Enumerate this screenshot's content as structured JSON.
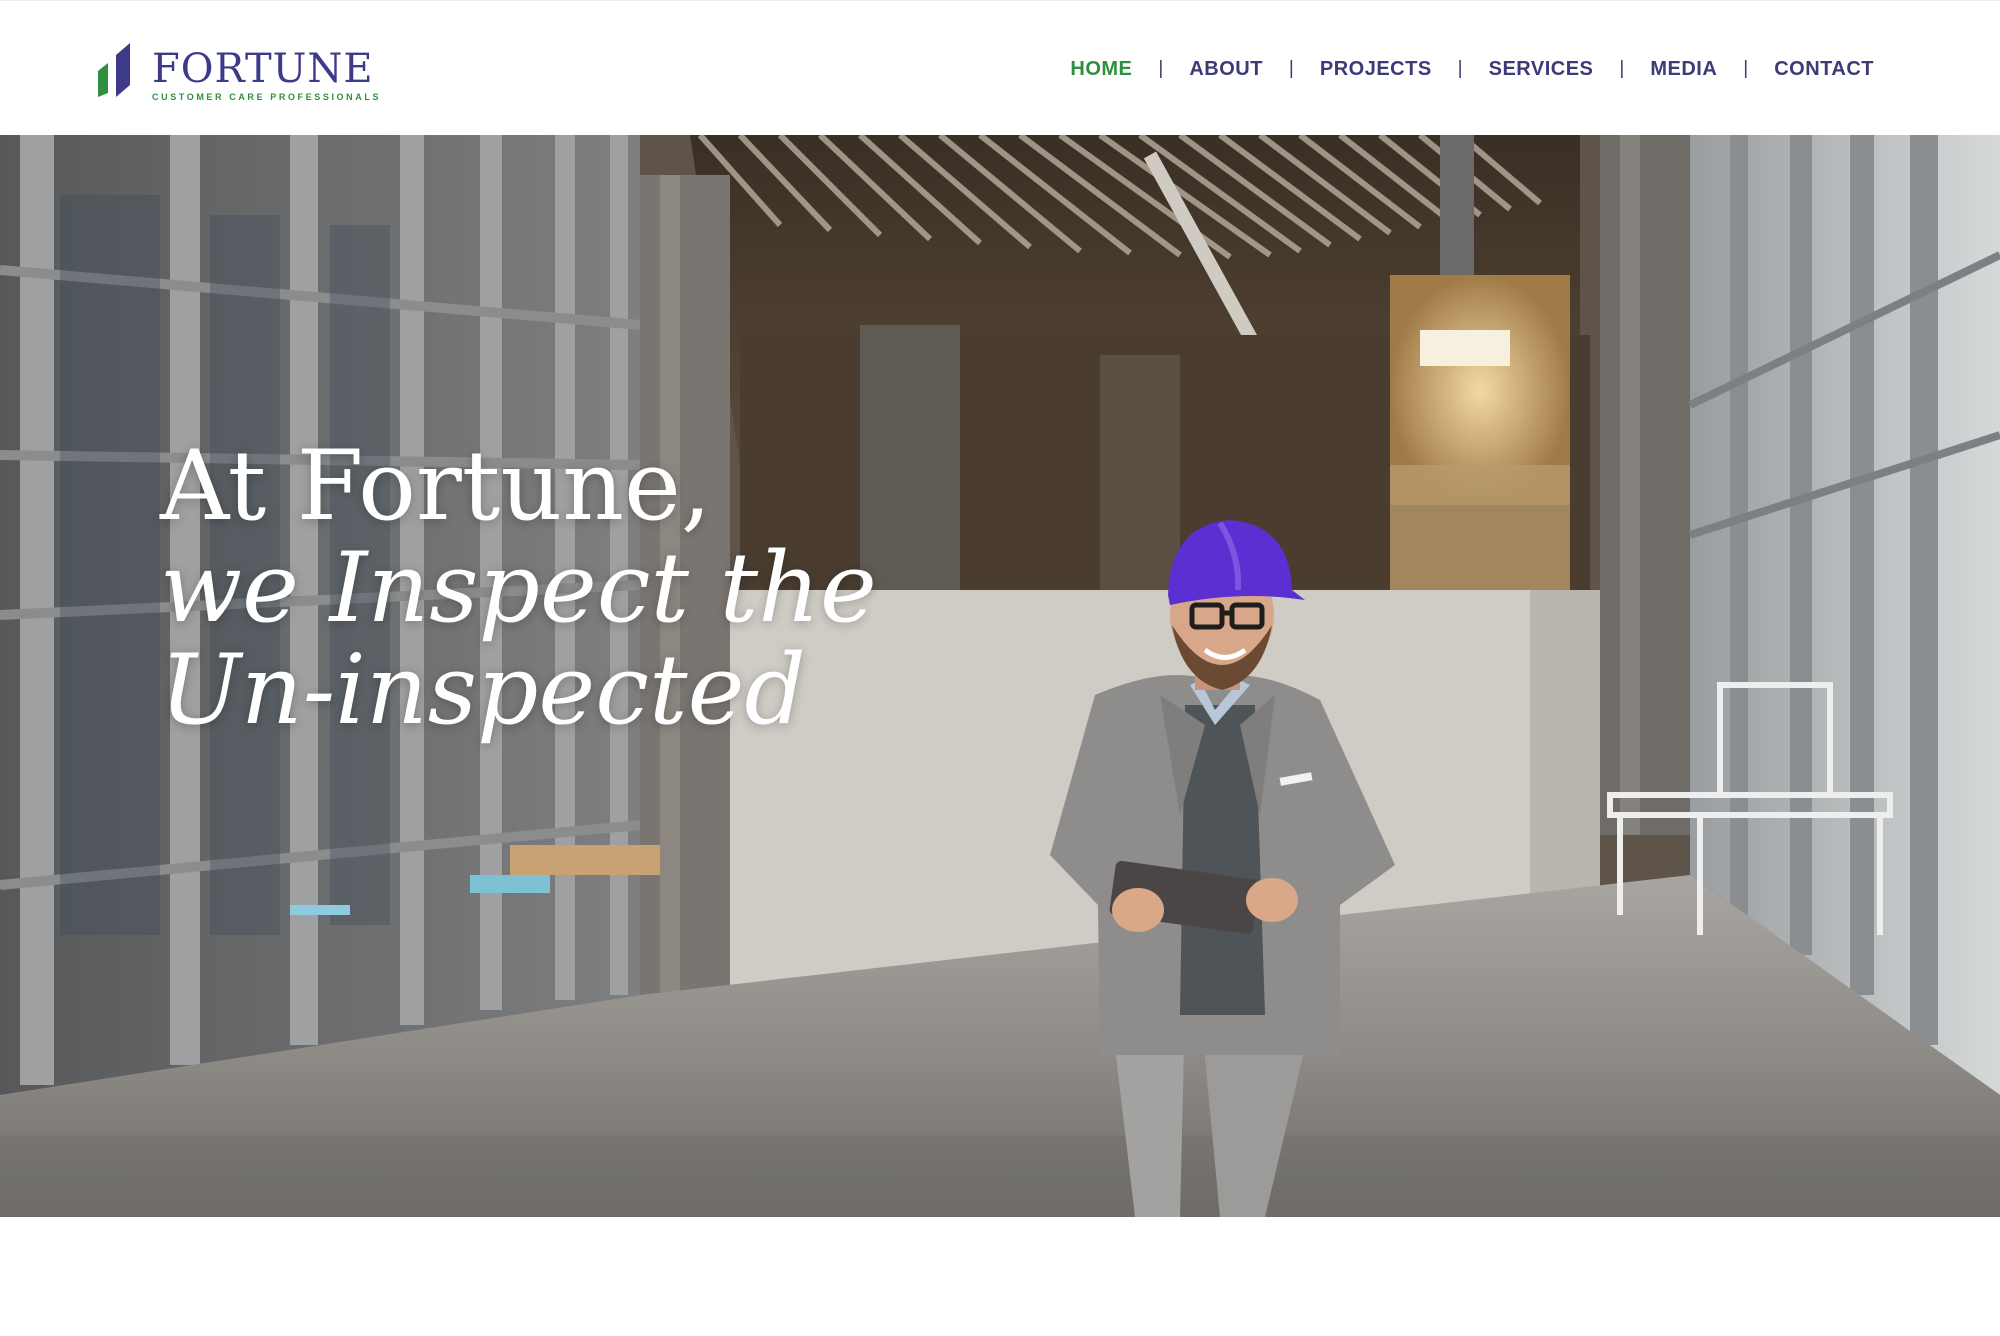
{
  "brand": {
    "name": "FORTUNE",
    "tagline": "CUSTOMER CARE PROFESSIONALS",
    "colors": {
      "primary": "#3d3a8a",
      "accent": "#2f8f3e"
    }
  },
  "nav": {
    "items": [
      {
        "label": "HOME",
        "active": true
      },
      {
        "label": "ABOUT",
        "active": false
      },
      {
        "label": "PROJECTS",
        "active": false
      },
      {
        "label": "SERVICES",
        "active": false
      },
      {
        "label": "MEDIA",
        "active": false
      },
      {
        "label": "CONTACT",
        "active": false
      }
    ],
    "separator": "|"
  },
  "hero": {
    "line1": "At Fortune,",
    "line2": "we Inspect the",
    "line3": "Un-inspected",
    "image": "engineer-with-purple-hard-hat-holding-tablet-in-construction-site"
  }
}
